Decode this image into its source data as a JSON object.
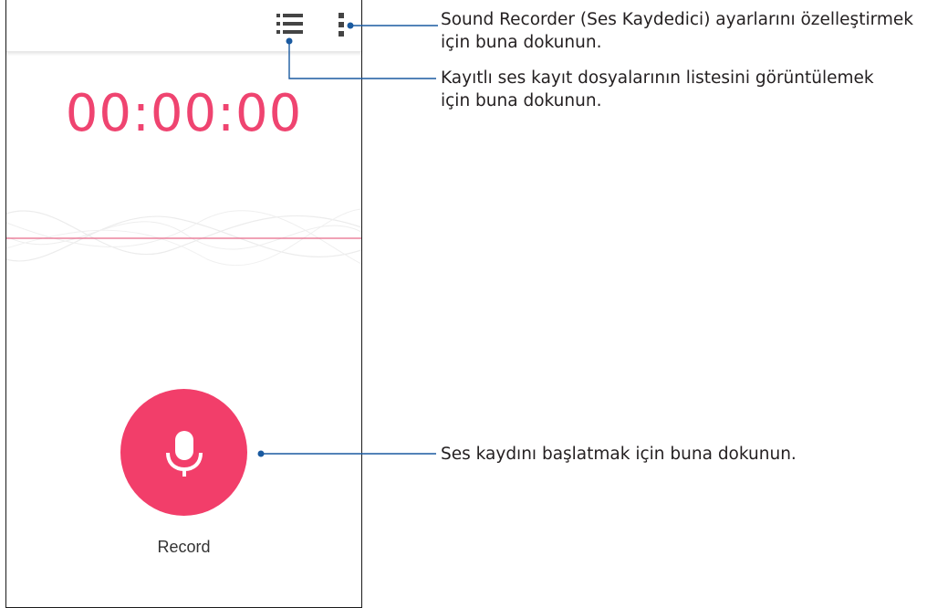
{
  "app": {
    "timer": "00:00:00",
    "record_label": "Record",
    "accent_color": "#f23e6a",
    "icons": {
      "list": "list-icon",
      "more": "more-vertical-icon",
      "mic": "microphone-icon"
    }
  },
  "callouts": {
    "settings_line1": "Sound Recorder (Ses Kaydedici) ayarlarını özelleştirmek",
    "settings_line2": "için buna dokunun.",
    "list_line1": "Kayıtlı ses kayıt dosyalarının listesini görüntülemek",
    "list_line2": "için buna dokunun.",
    "record": "Ses kaydını başlatmak için buna dokunun."
  }
}
